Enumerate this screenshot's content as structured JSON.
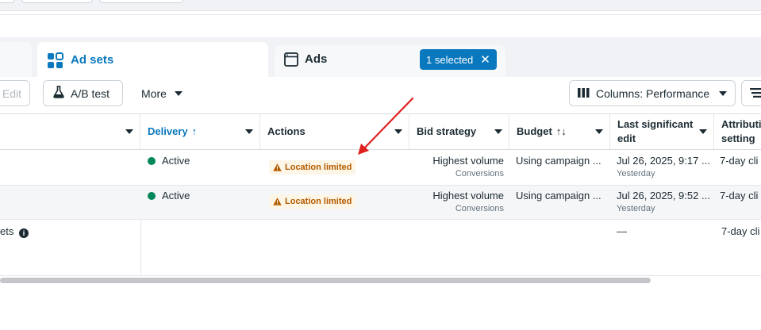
{
  "tabs": {
    "adsets_label": "Ad sets",
    "ads_label": "Ads",
    "selected_label": "1 selected"
  },
  "toolbar": {
    "edit_label": "Edit",
    "ab_test_label": "A/B test",
    "more_label": "More",
    "columns_label": "Columns: Performance"
  },
  "table": {
    "headers": {
      "delivery": "Delivery",
      "delivery_sort": "↑",
      "actions": "Actions",
      "bid_strategy": "Bid strategy",
      "budget": "Budget",
      "budget_sort": "↑↓",
      "last_edit": "Last significant edit",
      "attribution": "Attribution setting"
    },
    "rows": [
      {
        "delivery": "Active",
        "action": "Location limited",
        "bid": "Highest volume",
        "bid_sub": "Conversions",
        "budget": "Using campaign ...",
        "last_edit": "Jul 26, 2025, 9:17 ...",
        "last_edit_sub": "Yesterday",
        "attribution": "7-day cli"
      },
      {
        "delivery": "Active",
        "action": "Location limited",
        "bid": "Highest volume",
        "bid_sub": "Conversions",
        "budget": "Using campaign ...",
        "last_edit": "Jul 26, 2025, 9:52 ...",
        "last_edit_sub": "Yesterday",
        "attribution": "7-day cli"
      }
    ],
    "summary": {
      "label": "ets",
      "last_edit": "—",
      "attribution": "7-day cli"
    }
  },
  "colors": {
    "accent": "#0a78be",
    "active_dot": "#00875a",
    "warning": "#b35c00",
    "annotation_arrow": "#e02020"
  }
}
